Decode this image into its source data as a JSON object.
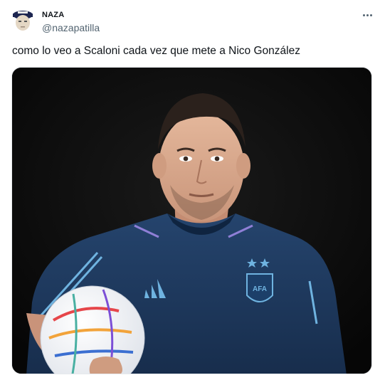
{
  "tweet": {
    "author_name": "NAZA",
    "author_handle": "@nazapatilla",
    "text": "como lo veo a Scaloni cada vez que mete a Nico González",
    "more_icon": "more-horizontal-icon",
    "avatar_icon": "avatar",
    "media_description_icon": "photo-man-argentina-training-shirt-with-ball",
    "shirt_badge": "AFA"
  },
  "colors": {
    "text_primary": "#0f1419",
    "text_secondary": "#536471",
    "media_background": "#080808",
    "shirt": "#1f3a5f",
    "shirt_accent": "#6fb3e0"
  }
}
